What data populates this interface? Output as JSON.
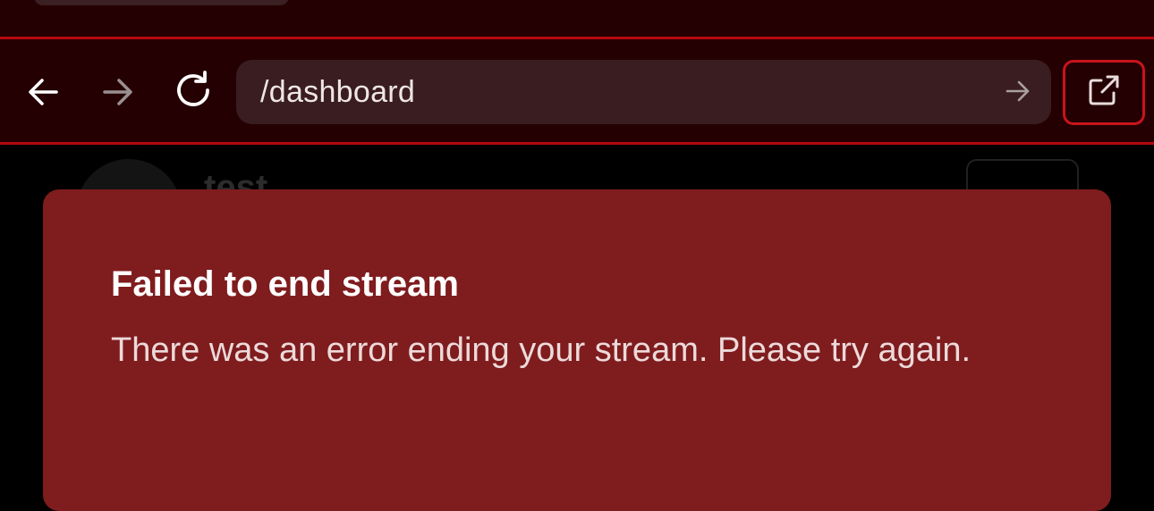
{
  "browser": {
    "url": "/dashboard",
    "accent_color": "#c8141b",
    "toolbar_bg": "#250002",
    "icons": {
      "back": "arrow-left-icon",
      "forward": "arrow-right-icon",
      "reload": "reload-icon",
      "go": "arrow-right-icon",
      "external": "external-link-icon"
    }
  },
  "background_page": {
    "user_name": "test"
  },
  "toast": {
    "title": "Failed to end stream",
    "message": "There was an error ending your stream. Please try again.",
    "bg_color": "#7f1c1e"
  }
}
